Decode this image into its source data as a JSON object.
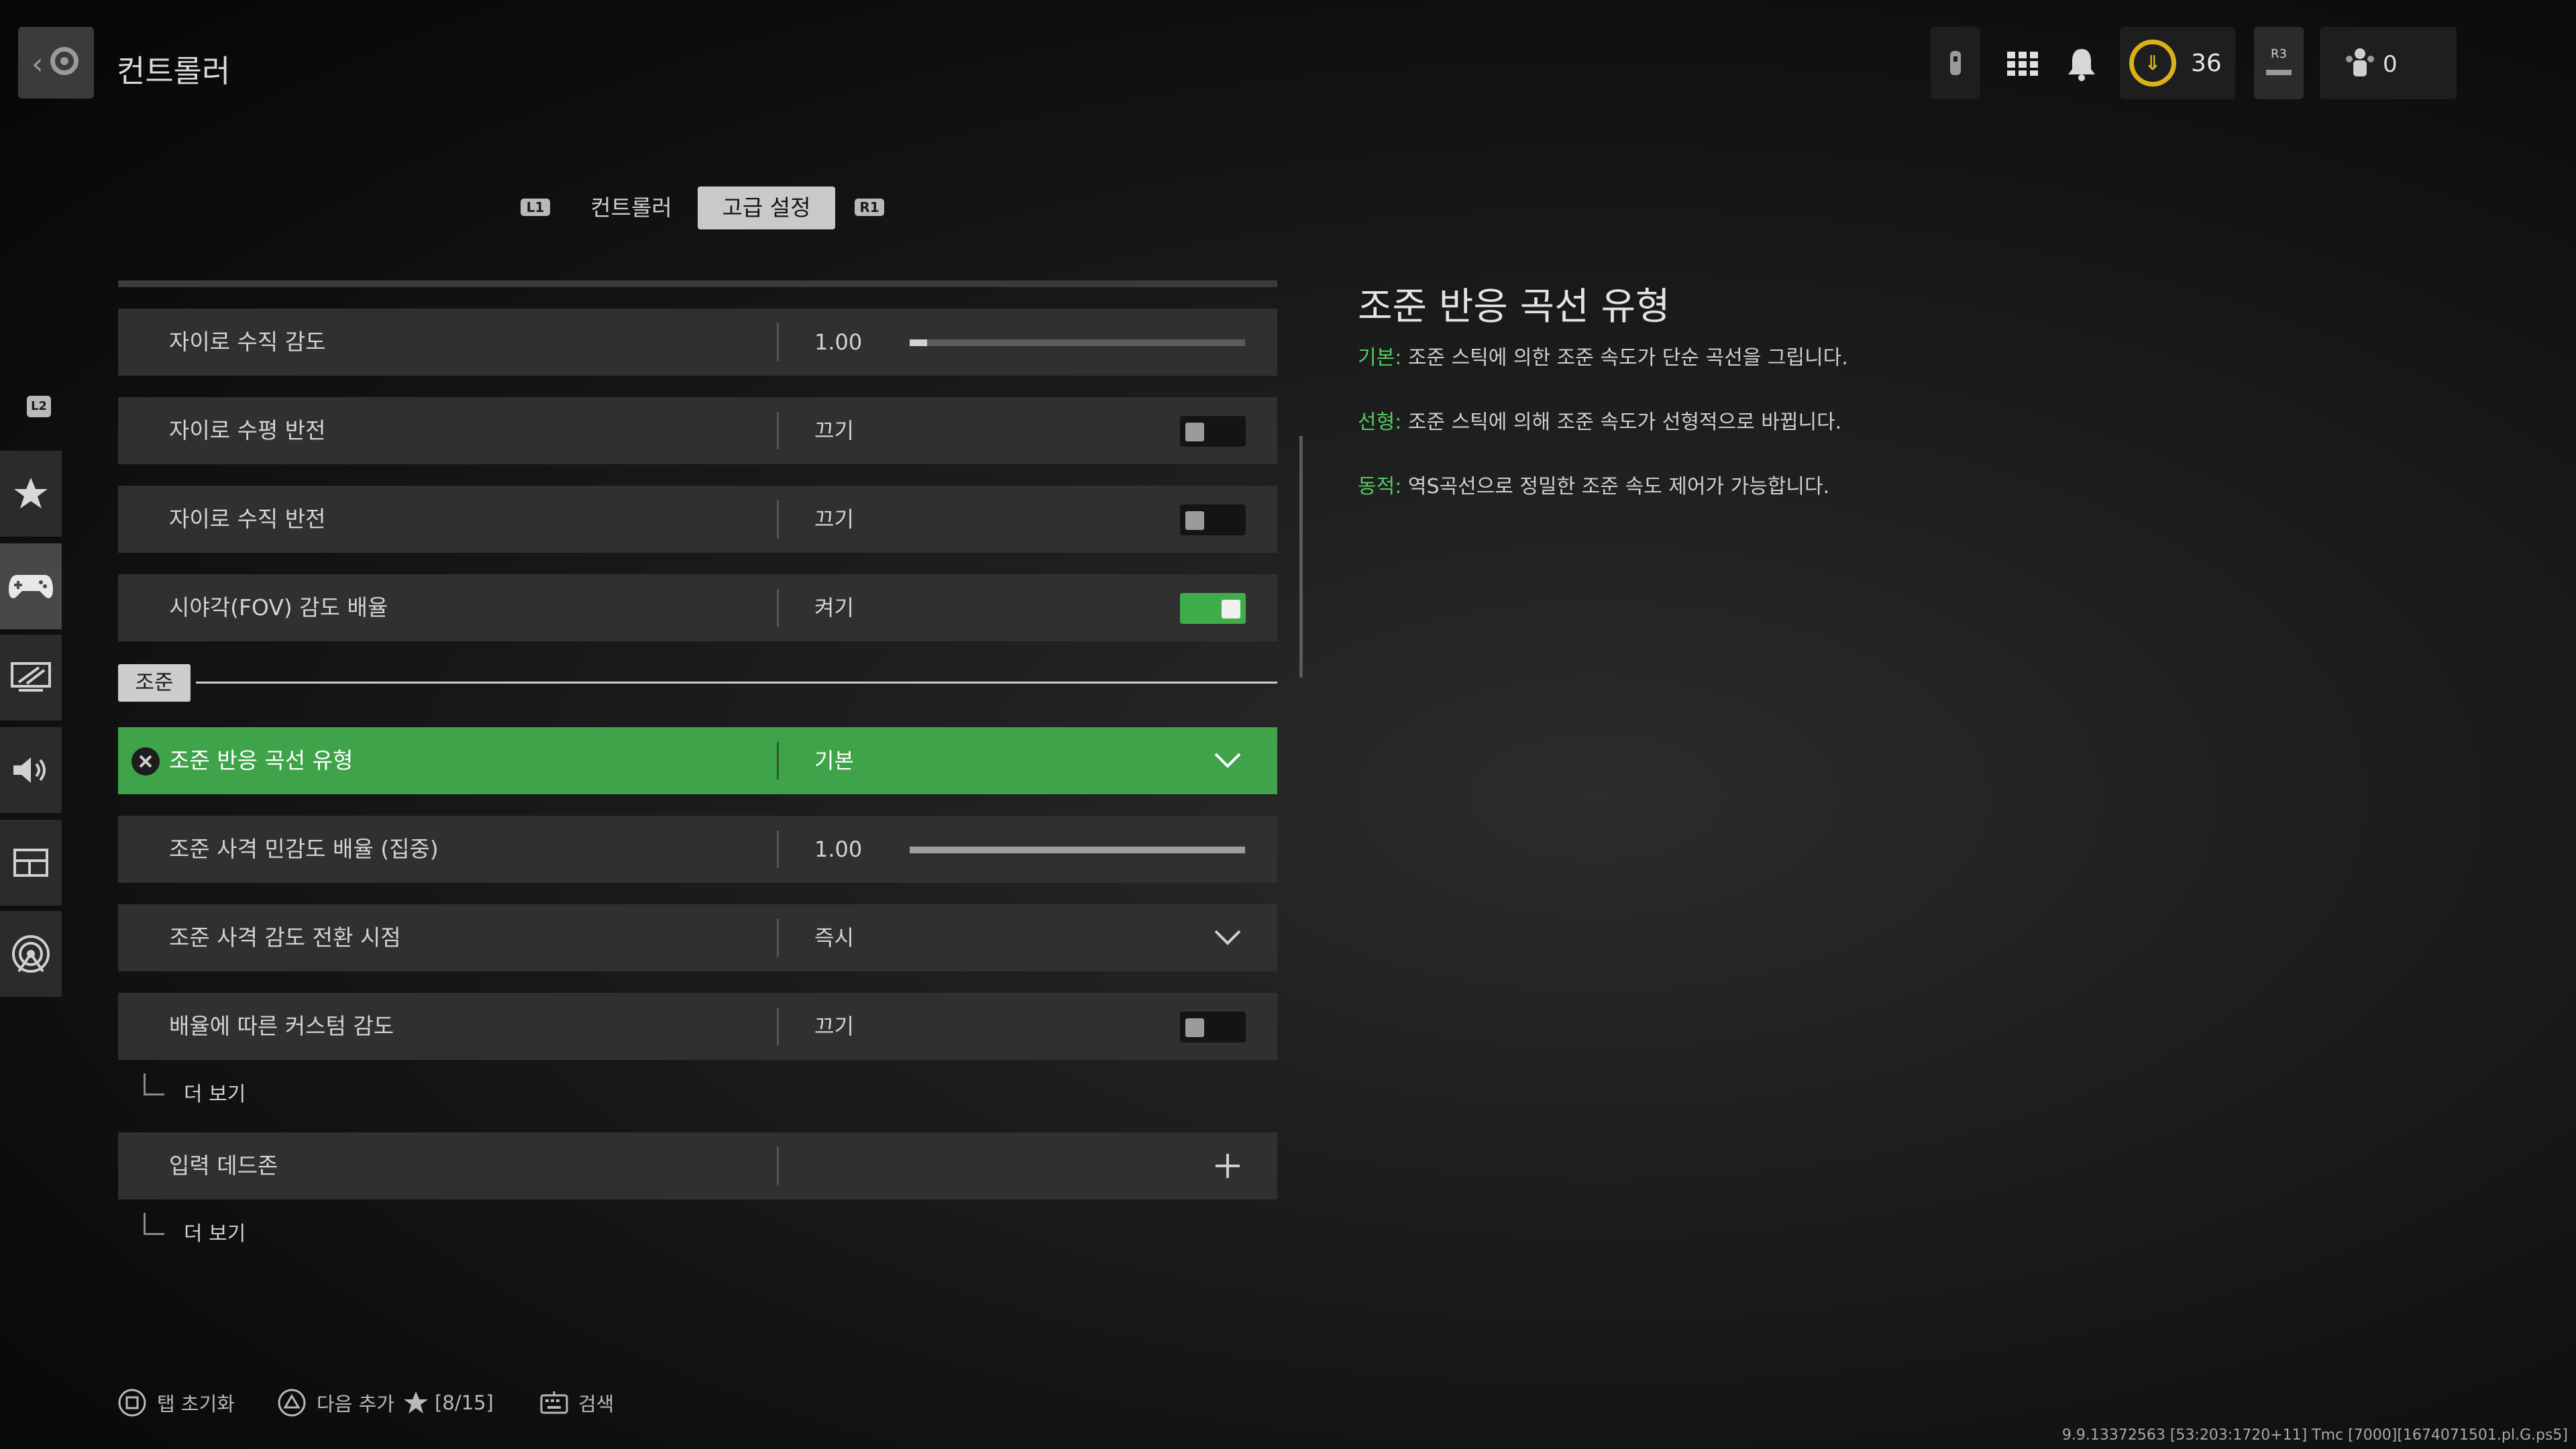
{
  "header": {
    "title": "컨트롤러",
    "currency_value": "36",
    "party_count": "0",
    "r3_hint": "R3"
  },
  "tabs": {
    "left_hint": "L1",
    "right_hint": "R1",
    "items": [
      {
        "label": "컨트롤러",
        "active": false
      },
      {
        "label": "고급 설정",
        "active": true
      }
    ]
  },
  "sidebar": {
    "hint": "L2",
    "items": [
      {
        "name": "favorites",
        "icon": "star-icon"
      },
      {
        "name": "controller",
        "icon": "gamepad-icon",
        "active": true
      },
      {
        "name": "graphics",
        "icon": "monitor-icon"
      },
      {
        "name": "audio",
        "icon": "speaker-icon"
      },
      {
        "name": "interface",
        "icon": "layout-icon"
      },
      {
        "name": "network",
        "icon": "network-icon"
      }
    ]
  },
  "settings": {
    "rows": [
      {
        "label": "자이로 수직 감도",
        "value": "1.00",
        "control": "slider",
        "fill": 0.05
      },
      {
        "label": "자이로 수평 반전",
        "value": "끄기",
        "control": "toggle",
        "on": false
      },
      {
        "label": "자이로 수직 반전",
        "value": "끄기",
        "control": "toggle",
        "on": false
      },
      {
        "label": "시야각(FOV) 감도 배율",
        "value": "켜기",
        "control": "toggle",
        "on": true
      }
    ],
    "section": "조준",
    "aim_rows": [
      {
        "label": "조준 반응 곡선 유형",
        "value": "기본",
        "control": "dropdown",
        "selected": true
      },
      {
        "label": "조준 사격 민감도 배율 (집중)",
        "value": "1.00",
        "control": "slider",
        "fill": 1.0
      },
      {
        "label": "조준 사격 감도 전환 시점",
        "value": "즉시",
        "control": "dropdown"
      },
      {
        "label": "배율에 따른 커스텀 감도",
        "value": "끄기",
        "control": "toggle",
        "on": false
      }
    ],
    "more_label_1": "더 보기",
    "deadzone": {
      "label": "입력 데드존"
    },
    "more_label_2": "더 보기"
  },
  "description": {
    "title": "조준 반응 곡선 유형",
    "lines": [
      {
        "key": "기본:",
        "text": " 조준 스틱에 의한 조준 속도가 단순 곡선을 그립니다."
      },
      {
        "key": "선형:",
        "text": " 조준 스틱에 의해 조준 속도가 선형적으로 바뀝니다."
      },
      {
        "key": "동적:",
        "text": " 역S곡선으로 정밀한 조준 속도 제어가 가능합니다."
      }
    ]
  },
  "footer": {
    "reset_label": "탭 초기화",
    "next_label": "다음 추가",
    "next_count": "[8/15]",
    "search_label": "검색",
    "version": "9.9.13372563 [53:203:1720+11] Tmc [7000][1674071501.pl.G.ps5]"
  },
  "colors": {
    "accent_green": "#3fa349",
    "gold": "#d9b21a"
  }
}
